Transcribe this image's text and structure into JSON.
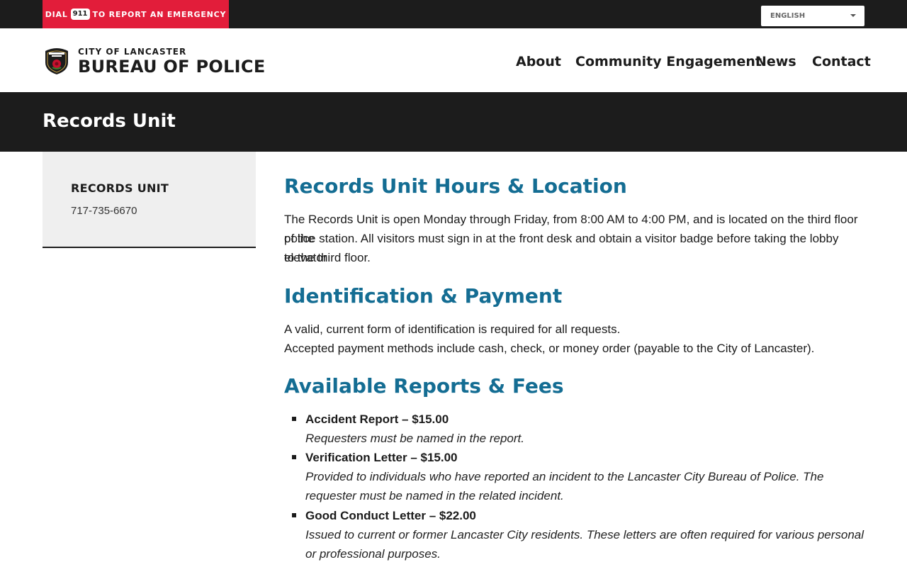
{
  "emergency": {
    "prefix": "DIAL",
    "number": "911",
    "suffix": "TO REPORT AN EMERGENCY"
  },
  "language": {
    "selected": "ENGLISH"
  },
  "brand": {
    "small": "CITY OF LANCASTER",
    "big": "BUREAU OF POLICE"
  },
  "nav": [
    {
      "label": "About"
    },
    {
      "label": "Community Engagement"
    },
    {
      "label": "News"
    },
    {
      "label": "Contact"
    }
  ],
  "banner": {
    "title": "Records Unit"
  },
  "sidebar": {
    "title": "RECORDS UNIT",
    "phone": "717-735-6670"
  },
  "sections": {
    "hours": {
      "heading": "Records Unit Hours & Location",
      "line1": "The Records Unit is open Monday through Friday, from 8:00 AM to 4:00 PM, and is located on the third floor of the",
      "line2": "police station. All visitors must sign in at the front desk and obtain a visitor badge before taking the lobby elevator",
      "line3": "to the third floor."
    },
    "id": {
      "heading": "Identification & Payment",
      "line1": "A valid, current form of identification is required for all requests.",
      "line2": "Accepted payment methods include cash, check, or money order (payable to the City of Lancaster)."
    },
    "reports": {
      "heading": "Available Reports & Fees",
      "items": [
        {
          "name": "Accident Report – $15.00",
          "desc": "Requesters must be named in the report."
        },
        {
          "name": "Verification Letter – $15.00",
          "desc": "Provided to individuals who have reported an incident to the Lancaster City Bureau of Police. The requester must be named in the related incident."
        },
        {
          "name": "Good Conduct Letter – $22.00",
          "desc": "Issued to current or former Lancaster City residents. These letters are often required for various personal or professional purposes."
        }
      ]
    }
  },
  "colors": {
    "accent": "#e21d3a",
    "heading": "#146d93",
    "dark": "#1c1c1c"
  }
}
